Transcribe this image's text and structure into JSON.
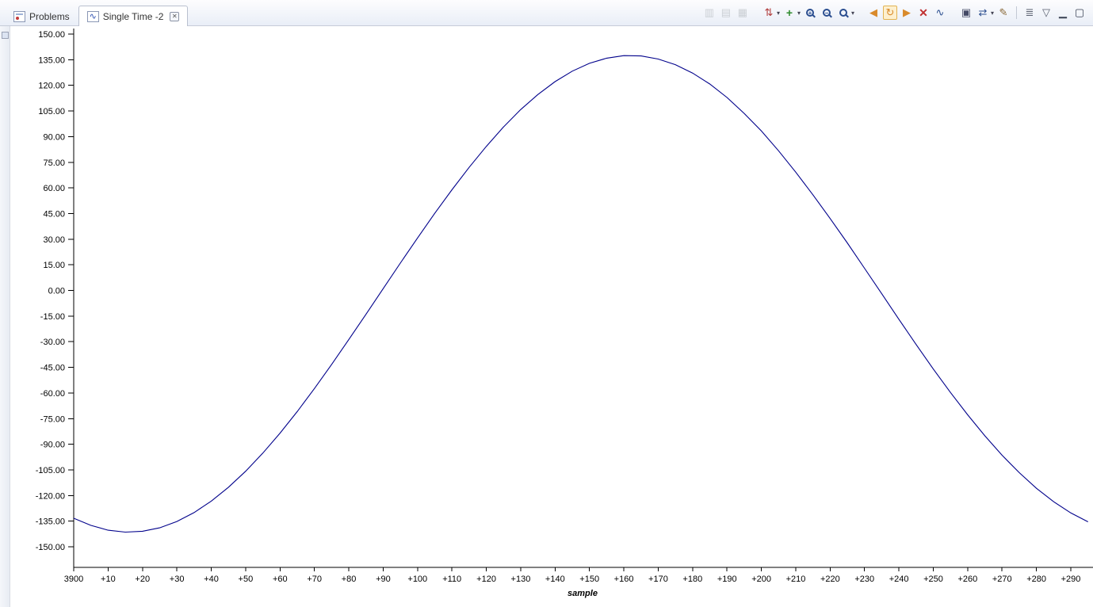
{
  "tabs": {
    "problems": {
      "label": "Problems"
    },
    "single_time": {
      "label": "Single Time -2",
      "icon_glyph": "∿",
      "close_glyph": "✕"
    }
  },
  "toolbar": {
    "icons": [
      {
        "name": "export-data-icon",
        "glyph": "▥",
        "color": "#9aa0a6",
        "disabled": true
      },
      {
        "name": "pin-data-icon",
        "glyph": "▤",
        "color": "#9aa0a6",
        "disabled": true
      },
      {
        "name": "import-data-icon",
        "glyph": "▦",
        "color": "#9aa0a6",
        "disabled": true
      },
      {
        "type": "gap"
      },
      {
        "name": "sort-icon",
        "glyph": "⇅",
        "color": "#b03a3a",
        "dropdown": true
      },
      {
        "name": "add-graph-icon",
        "glyph": "+",
        "color": "#2e8b2e",
        "bold": true,
        "dropdown": true
      },
      {
        "name": "zoom-in-icon",
        "kind": "mag",
        "glyph": "+"
      },
      {
        "name": "zoom-out-icon",
        "kind": "mag",
        "glyph": "−"
      },
      {
        "name": "zoom-fit-icon",
        "kind": "mag",
        "glyph": "",
        "dropdown": true
      },
      {
        "type": "gap"
      },
      {
        "name": "scroll-left-icon",
        "glyph": "◀",
        "color": "#d98a2b"
      },
      {
        "name": "sync-refresh-icon",
        "glyph": "↻",
        "color": "#d98a2b",
        "pressed": true
      },
      {
        "name": "scroll-right-icon",
        "glyph": "▶",
        "color": "#d98a2b"
      },
      {
        "name": "remove-all-icon",
        "glyph": "✕",
        "color": "#c03030",
        "bold": true
      },
      {
        "name": "graph-type-icon",
        "glyph": "∿",
        "color": "#2a4d8f"
      },
      {
        "type": "gap"
      },
      {
        "name": "freeze-data-icon",
        "glyph": "▣",
        "color": "#444a66"
      },
      {
        "name": "transfer-data-icon",
        "glyph": "⇄",
        "color": "#2a4d8f",
        "dropdown": true
      },
      {
        "name": "graph-properties-icon",
        "glyph": "✎",
        "color": "#8a6a3a"
      },
      {
        "type": "sep"
      },
      {
        "name": "view-menu-icon",
        "glyph": "≣",
        "color": "#5a6070"
      },
      {
        "name": "view-chevron-icon",
        "glyph": "▽",
        "color": "#5a6070"
      },
      {
        "name": "minimize-view-icon",
        "glyph": "▁",
        "color": "#3a4254"
      },
      {
        "name": "maximize-view-icon",
        "glyph": "▢",
        "color": "#3a4254"
      }
    ]
  },
  "chart_data": {
    "type": "line",
    "title": "Single Time -2",
    "xlabel": "sample",
    "ylabel": "",
    "start_sample": 3900,
    "grid": false,
    "legend": "none",
    "line_color": "#00008b",
    "xlim": [
      0,
      295
    ],
    "ylim": [
      -150,
      150
    ],
    "y_tick_labels": [
      "150.00",
      "135.00",
      "120.00",
      "105.00",
      "90.00",
      "75.00",
      "60.00",
      "45.00",
      "30.00",
      "15.00",
      "0.00",
      "-15.00",
      "-30.00",
      "-45.00",
      "-60.00",
      "-75.00",
      "-90.00",
      "-105.00",
      "-120.00",
      "-135.00",
      "-150.00"
    ],
    "x_tick_positions": [
      0,
      10,
      20,
      30,
      40,
      50,
      60,
      70,
      80,
      90,
      100,
      110,
      120,
      130,
      140,
      150,
      160,
      170,
      180,
      190,
      200,
      210,
      220,
      230,
      240,
      250,
      260,
      270,
      280,
      290
    ],
    "x_tick_labels": [
      "3900",
      "+10",
      "+20",
      "+30",
      "+40",
      "+50",
      "+60",
      "+70",
      "+80",
      "+90",
      "+100",
      "+110",
      "+120",
      "+130",
      "+140",
      "+150",
      "+160",
      "+170",
      "+180",
      "+190",
      "+200",
      "+210",
      "+220",
      "+230",
      "+240",
      "+250",
      "+260",
      "+270",
      "+280",
      "+290"
    ],
    "x": [
      0,
      5,
      10,
      15,
      20,
      25,
      30,
      35,
      40,
      45,
      50,
      55,
      60,
      65,
      70,
      75,
      80,
      85,
      90,
      95,
      100,
      105,
      110,
      115,
      120,
      125,
      130,
      135,
      140,
      145,
      150,
      155,
      160,
      165,
      170,
      175,
      180,
      185,
      190,
      195,
      200,
      205,
      210,
      215,
      220,
      225,
      230,
      235,
      240,
      245,
      250,
      255,
      260,
      265,
      270,
      275,
      280,
      285,
      290,
      295
    ],
    "values": [
      -133.3,
      -137.5,
      -140.3,
      -141.4,
      -140.9,
      -138.9,
      -135.2,
      -130.0,
      -123.3,
      -115.2,
      -105.8,
      -95.2,
      -83.5,
      -70.9,
      -57.4,
      -43.4,
      -28.8,
      -14.0,
      1.0,
      16.0,
      30.7,
      45.1,
      58.9,
      72.0,
      84.3,
      95.6,
      105.8,
      114.6,
      122.2,
      128.3,
      132.9,
      135.9,
      137.4,
      137.2,
      135.4,
      132.1,
      127.2,
      120.8,
      112.9,
      103.6,
      93.3,
      81.7,
      69.2,
      55.9,
      42.1,
      27.8,
      13.0,
      -1.9,
      -16.9,
      -31.6,
      -46.0,
      -59.7,
      -72.8,
      -85.1,
      -96.4,
      -106.6,
      -115.8,
      -123.6,
      -130.2,
      -135.4
    ]
  }
}
